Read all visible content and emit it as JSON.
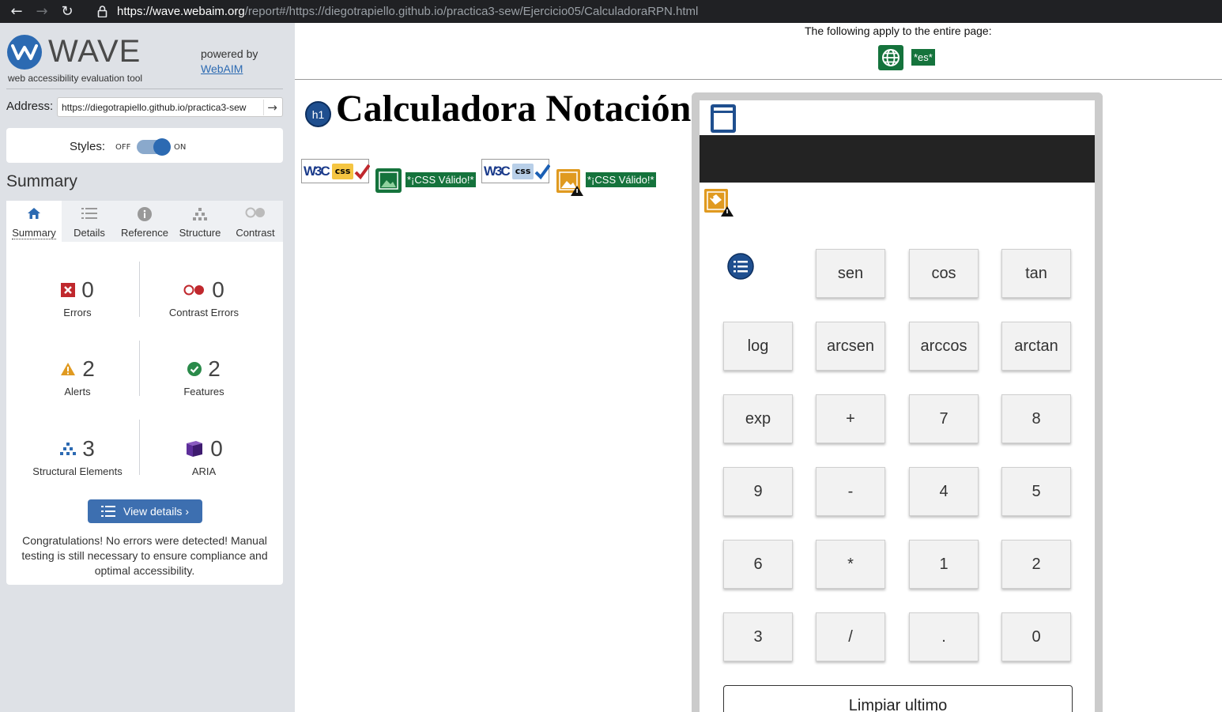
{
  "browser": {
    "url_host": "https://wave.webaim.org",
    "url_path": "/report#/https://diegotrapiello.github.io/practica3-sew/Ejercicio05/CalculadoraRPN.html"
  },
  "wave": {
    "logo_text": "WAVE",
    "tagline": "web accessibility evaluation tool",
    "powered_by": "powered by",
    "powered_link": "WebAIM",
    "address_label": "Address:",
    "address_value": "https://diegotrapiello.github.io/practica3-sew",
    "styles_label": "Styles:",
    "styles_off": "OFF",
    "styles_on": "ON",
    "summary_heading": "Summary",
    "tabs": [
      {
        "label": "Summary",
        "icon": "home-icon"
      },
      {
        "label": "Details",
        "icon": "list-icon"
      },
      {
        "label": "Reference",
        "icon": "info-icon"
      },
      {
        "label": "Structure",
        "icon": "structure-icon"
      },
      {
        "label": "Contrast",
        "icon": "contrast-icon"
      }
    ],
    "stats": {
      "errors": {
        "count": "0",
        "label": "Errors"
      },
      "contrast_errors": {
        "count": "0",
        "label": "Contrast Errors"
      },
      "alerts": {
        "count": "2",
        "label": "Alerts"
      },
      "features": {
        "count": "2",
        "label": "Features"
      },
      "structural": {
        "count": "3",
        "label": "Structural Elements"
      },
      "aria": {
        "count": "0",
        "label": "ARIA"
      }
    },
    "view_details": "View details ›",
    "congrats": "Congratulations! No errors were detected! Manual testing is still necessary to ensure compliance and optimal accessibility."
  },
  "page": {
    "notice": "The following apply to the entire page:",
    "lang_badge": "*es*",
    "h1_badge": "h1",
    "title": "Calculadora Notación Polaca Inversa",
    "w3c_text": "W3C",
    "css_text": "css",
    "valid_badge": "*¡CSS Válido!*"
  },
  "calculator": {
    "buttons": [
      "sen",
      "cos",
      "tan",
      "log",
      "arcsen",
      "arccos",
      "arctan",
      "exp",
      "+",
      "7",
      "8",
      "9",
      "-",
      "4",
      "5",
      "6",
      "*",
      "1",
      "2",
      "3",
      "/",
      ".",
      "0"
    ],
    "clear_last": "Limpiar ultimo"
  },
  "colors": {
    "wave_blue": "#2c6ab2",
    "wave_green": "#15733c",
    "sidebar_bg": "#dee1e6",
    "error_red": "#c0282d",
    "alert_orange": "#e09a20"
  }
}
